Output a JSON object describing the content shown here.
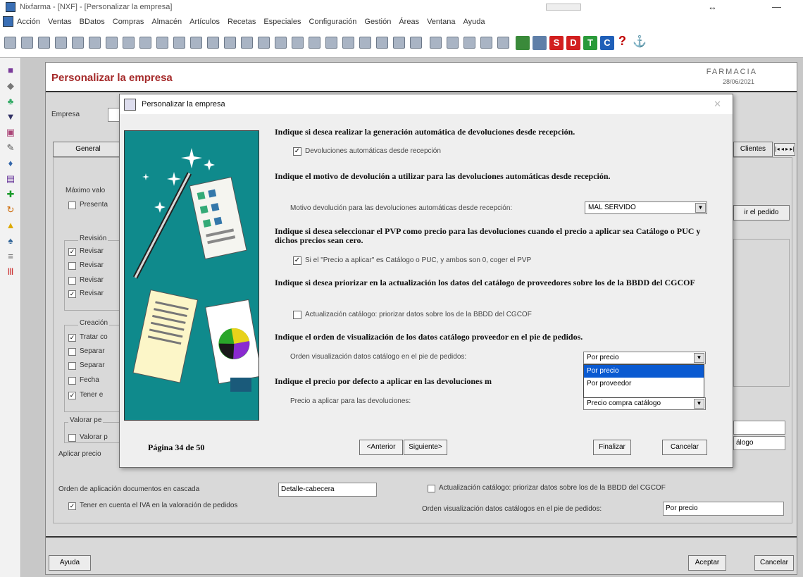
{
  "window": {
    "title": "Nixfarma - [NXF] - [Personalizar la empresa]"
  },
  "menu": [
    "Acción",
    "Ventas",
    "BDatos",
    "Compras",
    "Almacén",
    "Artículos",
    "Recetas",
    "Especiales",
    "Configuración",
    "Gestión",
    "Áreas",
    "Ventana",
    "Ayuda"
  ],
  "toolbar": {
    "colored_buttons": [
      "S",
      "D",
      "T",
      "C"
    ],
    "question": "?"
  },
  "main": {
    "title": "Personalizar la empresa",
    "farmacia": "FARMACIA",
    "date": "28/06/2021",
    "empresa_label": "Empresa",
    "tab_general": "General",
    "tab_right": "Clientes",
    "left": {
      "maximo": "Máximo valo",
      "presentar": "Presenta",
      "revision_label": "Revisión",
      "revisar": [
        "Revisar",
        "Revisar",
        "Revisar",
        "Revisar"
      ],
      "creacion_label": "Creación",
      "creacion_items": [
        "Tratar co",
        "Separar",
        "Separar",
        "Fecha",
        "Tener e"
      ],
      "valorar_label": "Valorar pe",
      "valorar_item": "Valorar p",
      "aplicar": "Aplicar precio",
      "orden_label": "Orden de aplicación documentos en cascada",
      "orden_value": "Detalle-cabecera",
      "tener_iva": "Tener en cuenta el IVA en la valoración de pedidos"
    },
    "right": {
      "pedido_btn": "ir el pedido",
      "catalogo": "álogo",
      "actualizacion": "Actualización catálogo: priorizar datos sobre los de la BBDD del CGCOF",
      "orden_label": "Orden visualización datos catálogos en el pie de pedidos:",
      "orden_value": "Por precio"
    },
    "buttons": {
      "ayuda": "Ayuda",
      "aceptar": "Aceptar",
      "cancelar": "Cancelar"
    }
  },
  "dialog": {
    "title": "Personalizar la empresa",
    "q1": "Indique si desea realizar la generación automática de devoluciones desde recepción.",
    "q1_option": "Devoluciones automáticas desde recepción",
    "q2": "Indique el motivo de devolución a utilizar para las devoluciones automáticas desde recepción.",
    "q2_label": "Motivo devolución para las devoluciones automáticas desde recepción:",
    "q2_value": "MAL SERVIDO",
    "q3": "Indique si desea seleccionar el PVP como precio para las devoluciones cuando el precio a aplicar sea Catálogo o PUC y dichos precios sean cero.",
    "q3_option": "Si el \"Precio a aplicar\" es Catálogo o PUC, y ambos son 0, coger el PVP",
    "q4": "Indique si desea priorizar en la actualización los datos del catálogo de proveedores sobre los de la BBDD del CGCOF",
    "q4_option": "Actualización catálogo: priorizar datos sobre los de la BBDD del CGCOF",
    "q5": "Indique el orden de visualización de los datos catálogo proveedor en el pie de pedidos.",
    "q5_label": "Orden visualización datos catálogo en el pie de pedidos:",
    "q5_value": "Por precio",
    "q5_options": [
      "Por precio",
      "Por proveedor"
    ],
    "q6": "Indique el precio por defecto a aplicar en las devoluciones m",
    "q6_label": "Precio a aplicar para las devoluciones:",
    "q6_value": "Precio compra catálogo",
    "page": "Página 34 de 50",
    "buttons": {
      "anterior": "<Anterior",
      "siguiente": "Siguiente>",
      "finalizar": "Finalizar",
      "cancelar": "Cancelar"
    },
    "checks": {
      "q1": true,
      "q3": true,
      "q4": false
    }
  }
}
